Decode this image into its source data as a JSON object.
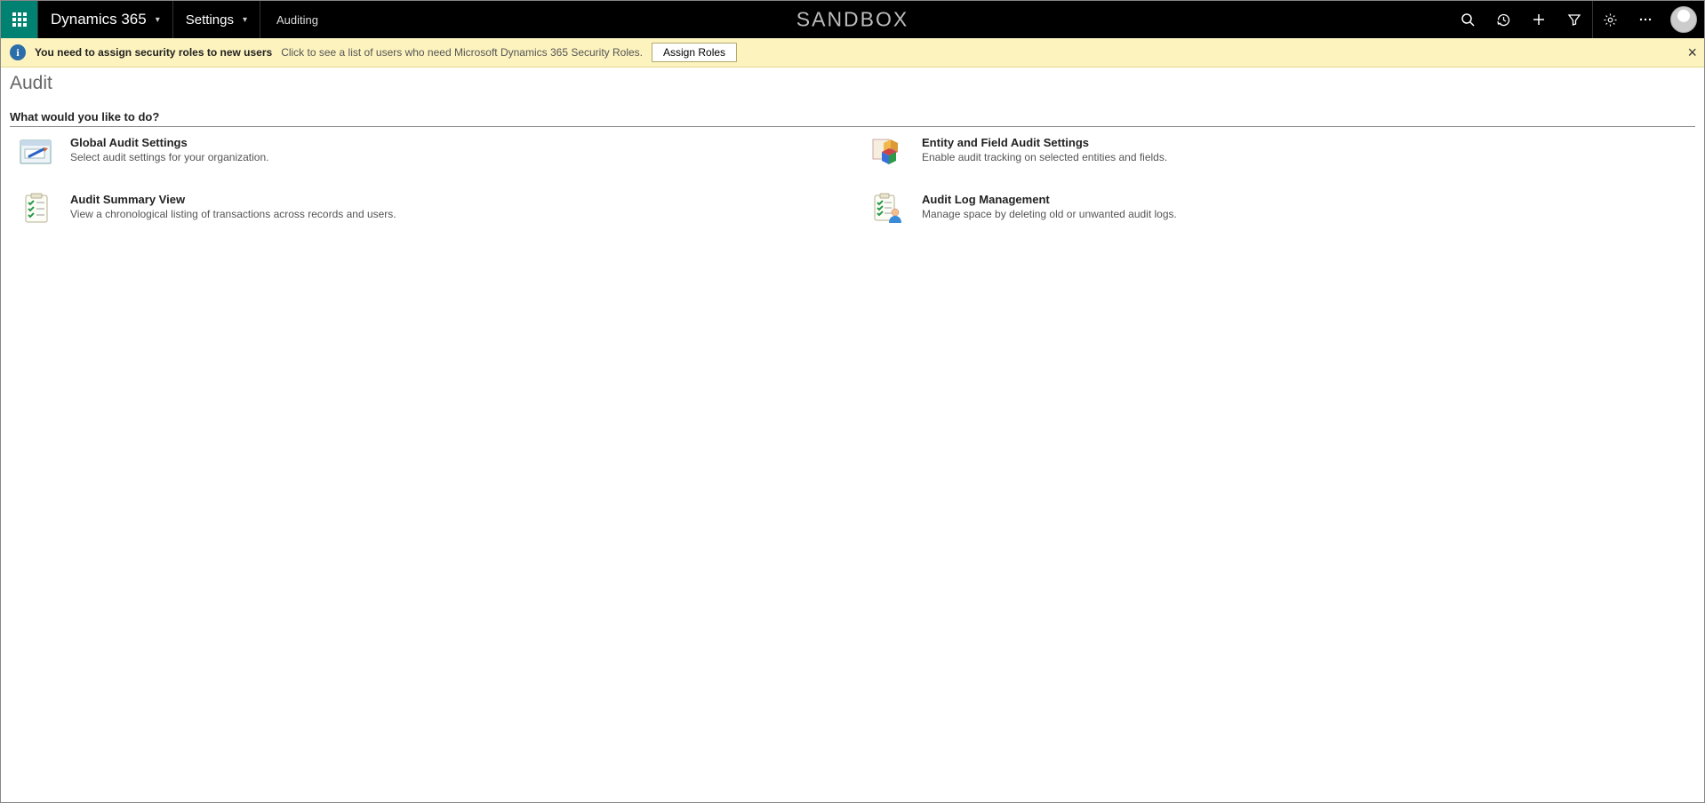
{
  "topbar": {
    "brand": "Dynamics 365",
    "nav": "Settings",
    "breadcrumb": "Auditing",
    "env_label": "SANDBOX"
  },
  "notice": {
    "title": "You need to assign security roles to new users",
    "subtitle": "Click to see a list of users who need Microsoft Dynamics 365 Security Roles.",
    "button": "Assign Roles"
  },
  "page": {
    "title": "Audit",
    "question": "What would you like to do?"
  },
  "options": [
    {
      "title": "Global Audit Settings",
      "desc": "Select audit settings for your organization."
    },
    {
      "title": "Entity and Field Audit Settings",
      "desc": "Enable audit tracking on selected entities and fields."
    },
    {
      "title": "Audit Summary View",
      "desc": "View a chronological listing of transactions across records and users."
    },
    {
      "title": "Audit Log Management",
      "desc": "Manage space by deleting old or unwanted audit logs."
    }
  ]
}
